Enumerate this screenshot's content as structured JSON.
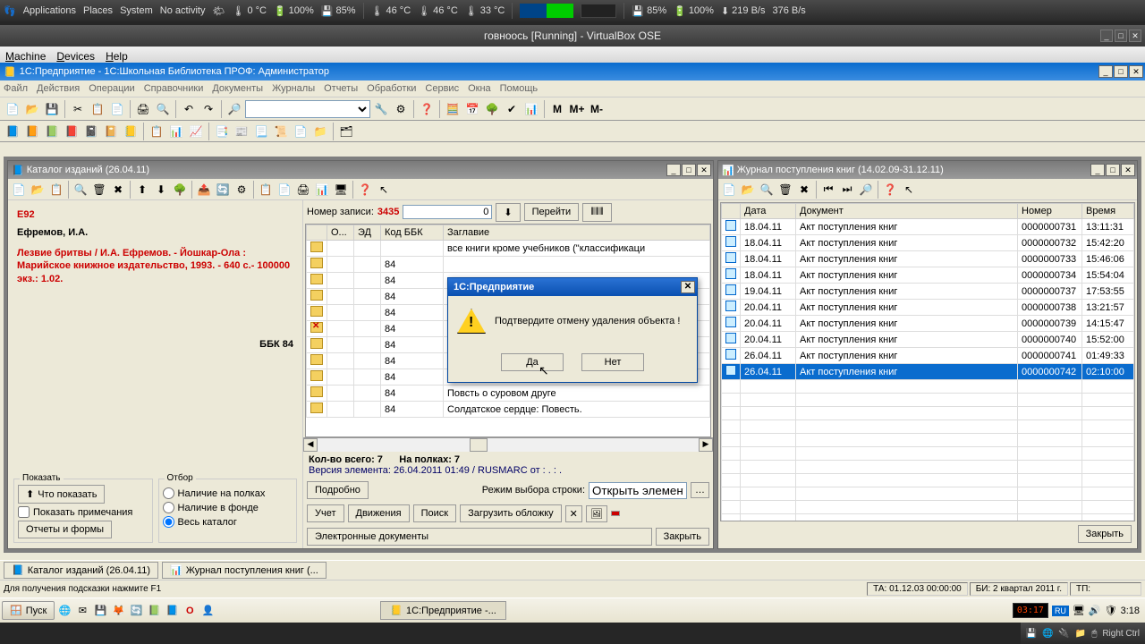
{
  "gnome": {
    "apps": "Applications",
    "places": "Places",
    "system": "System",
    "activity": "No activity",
    "temp1": "0 °C",
    "pct1": "100%",
    "pct2": "85%",
    "temp2": "46 °C",
    "temp3": "46 °C",
    "temp4": "33 °C",
    "pct3": "85%",
    "pct4": "100%",
    "net_down": "219 B/s",
    "net_up": "376 B/s"
  },
  "vbox": {
    "title": "говноось [Running] - VirtualBox OSE",
    "menu": {
      "machine": "Machine",
      "devices": "Devices",
      "help": "Help"
    },
    "status_key": "Right Ctrl"
  },
  "app": {
    "title": "1С:Предприятие - 1С:Школьная Библиотека ПРОФ:  Администратор",
    "menu": [
      "Файл",
      "Действия",
      "Операции",
      "Справочники",
      "Документы",
      "Журналы",
      "Отчеты",
      "Обработки",
      "Сервис",
      "Окна",
      "Помощь"
    ],
    "m_buttons": [
      "M",
      "M+",
      "M-"
    ]
  },
  "catalog": {
    "title": "Каталог изданий (26.04.11)",
    "e92": "Е92",
    "author": "Ефремов, И.А.",
    "descr": "Лезвие бритвы / И.А. Ефремов. - Йошкар-Ола : Марийское книжное издательство, 1993. - 640 с.- 100000 экз.: 1.02.",
    "bbk": "ББК 84",
    "show_group": "Показать",
    "filter_group": "Отбор",
    "btn_what": "Что показать",
    "chk_notes": "Показать примечания",
    "btn_reports": "Отчеты и формы",
    "radio1": "Наличие на полках",
    "radio2": "Наличие в фонде",
    "radio3": "Весь каталог",
    "rec_label": "Номер записи:",
    "rec_value": "3435",
    "rec_input": "0",
    "btn_goto": "Перейти",
    "cols": [
      "О...",
      "ЭД",
      "Код ББК",
      "Заглавие"
    ],
    "first_row_title": "все книги кроме учебников (\"классификаци",
    "rows": [
      {
        "bbk": "84",
        "title": ""
      },
      {
        "bbk": "84",
        "title": ""
      },
      {
        "bbk": "84",
        "title": ""
      },
      {
        "bbk": "84",
        "title": ""
      },
      {
        "bbk": "84",
        "title": "",
        "del": true
      },
      {
        "bbk": "84",
        "title": ""
      },
      {
        "bbk": "84",
        "title": ""
      },
      {
        "bbk": "84",
        "title": ""
      },
      {
        "bbk": "84",
        "title": "Повсть о суровом друге"
      },
      {
        "bbk": "84",
        "title": "Солдатское сердце: Повесть."
      }
    ],
    "sum_total_l": "Кол-во всего: 7",
    "sum_shelf_l": "На полках:   7",
    "version": "Версия элемента: 26.04.2011 01:49 / RUSMARC от : . : .",
    "btn_detail": "Подробно",
    "mode_label": "Режим выбора строки:",
    "mode_value": "Открыть элемент",
    "btn_uchet": "Учет",
    "btn_mov": "Движения",
    "btn_search": "Поиск",
    "btn_cover": "Загрузить обложку",
    "btn_edoc": "Электронные документы",
    "btn_close": "Закрыть"
  },
  "journal": {
    "title": "Журнал поступления книг (14.02.09-31.12.11)",
    "cols": [
      "",
      "Дата",
      "Документ",
      "Номер",
      "Время"
    ],
    "rows": [
      {
        "d": "18.04.11",
        "doc": "Акт поступления книг",
        "n": "0000000731",
        "t": "13:11:31"
      },
      {
        "d": "18.04.11",
        "doc": "Акт поступления книг",
        "n": "0000000732",
        "t": "15:42:20"
      },
      {
        "d": "18.04.11",
        "doc": "Акт поступления книг",
        "n": "0000000733",
        "t": "15:46:06"
      },
      {
        "d": "18.04.11",
        "doc": "Акт поступления книг",
        "n": "0000000734",
        "t": "15:54:04"
      },
      {
        "d": "19.04.11",
        "doc": "Акт поступления книг",
        "n": "0000000737",
        "t": "17:53:55"
      },
      {
        "d": "20.04.11",
        "doc": "Акт поступления книг",
        "n": "0000000738",
        "t": "13:21:57"
      },
      {
        "d": "20.04.11",
        "doc": "Акт поступления книг",
        "n": "0000000739",
        "t": "14:15:47"
      },
      {
        "d": "20.04.11",
        "doc": "Акт поступления книг",
        "n": "0000000740",
        "t": "15:52:00"
      },
      {
        "d": "26.04.11",
        "doc": "Акт поступления книг",
        "n": "0000000741",
        "t": "01:49:33"
      },
      {
        "d": "26.04.11",
        "doc": "Акт поступления книг",
        "n": "0000000742",
        "t": "02:10:00",
        "sel": true
      }
    ],
    "btn_close": "Закрыть"
  },
  "dialog": {
    "title": "1С:Предприятие",
    "msg": "Подтвердите отмену удаления объекта !",
    "yes": "Да",
    "no": "Нет"
  },
  "mdi_tabs": {
    "tab1": "Каталог изданий (26.04.11)",
    "tab2": "Журнал поступления книг (..."
  },
  "status": {
    "hint": "Для получения подсказки нажмите F1",
    "ta": "ТА: 01.12.03  00:00:00",
    "bi": "БИ: 2 квартал 2011 г.",
    "tp": "ТП:"
  },
  "win_tb": {
    "start": "Пуск",
    "app": "1С:Предприятие -...",
    "clock_red": "03:17",
    "clock": "3:18",
    "lang": "RU"
  }
}
